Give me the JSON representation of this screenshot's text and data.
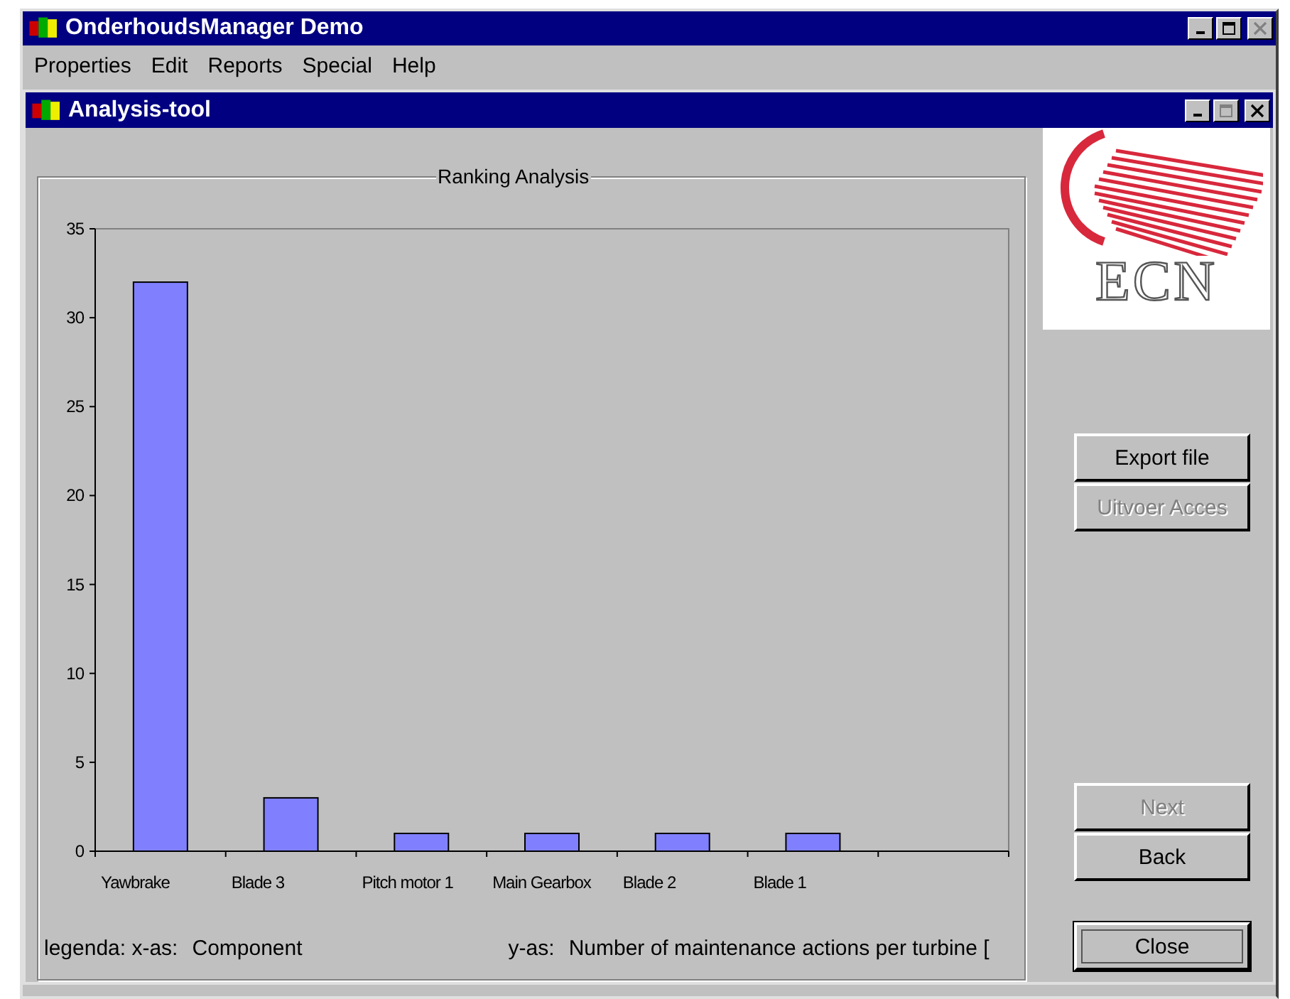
{
  "window": {
    "title": "OnderhoudsManager Demo"
  },
  "menu": [
    {
      "label": "Properties"
    },
    {
      "label": "Edit"
    },
    {
      "label": "Reports"
    },
    {
      "label": "Special"
    },
    {
      "label": "Help"
    }
  ],
  "child_window": {
    "title": "Analysis-tool"
  },
  "chart_panel": {
    "title": "Ranking Analysis",
    "chart_data": {
      "type": "bar",
      "categories": [
        "Yawbrake",
        "Blade 3",
        "Pitch motor 1",
        "Main Gearbox",
        "Blade 2",
        "Blade 1"
      ],
      "series": [
        {
          "color": "#8080ff",
          "values": [
            32,
            3,
            1,
            1,
            1,
            1
          ]
        }
      ],
      "ylim": [
        0,
        35
      ],
      "yticks": [
        0,
        5,
        10,
        15,
        20,
        25,
        30,
        35
      ]
    },
    "legend": {
      "x_label": "legenda: x-as:",
      "x_value": "Component",
      "y_label": "y-as:",
      "y_value": "Number of maintenance actions per turbine ["
    }
  },
  "logo": {
    "text": "ECN"
  },
  "buttons_top": [
    {
      "label": "Export file",
      "disabled": false,
      "default": false
    },
    {
      "label": "Uitvoer Acces",
      "disabled": true,
      "default": false
    }
  ],
  "buttons_nav": [
    {
      "label": "Next",
      "disabled": true,
      "default": false
    },
    {
      "label": "Back",
      "disabled": false,
      "default": false
    }
  ],
  "close_button": {
    "label": "Close",
    "disabled": false,
    "default": true
  }
}
